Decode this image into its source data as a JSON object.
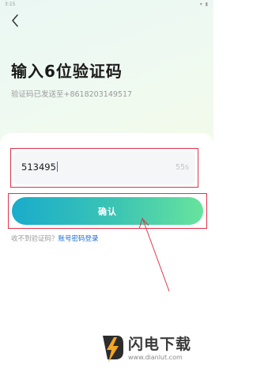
{
  "status_bar": {
    "time": "3:15",
    "icons": "▾ ▮"
  },
  "header": {
    "back_icon": "chevron-left-icon"
  },
  "page": {
    "title": "输入6位验证码",
    "subtitle": "验证码已发送至+8618203149517"
  },
  "code_input": {
    "value": "513495",
    "countdown": "55s"
  },
  "confirm_button": {
    "label": "确认"
  },
  "help": {
    "prefix": "收不到验证码？",
    "link": "账号密码登录"
  },
  "watermark": {
    "name": "闪电下载",
    "url": "www.dianlut.com"
  },
  "colors": {
    "annotation_red": "#e0334a",
    "button_gradient_start": "#1aaccb",
    "button_gradient_end": "#68e39d",
    "link_blue": "#1f6fd6"
  }
}
